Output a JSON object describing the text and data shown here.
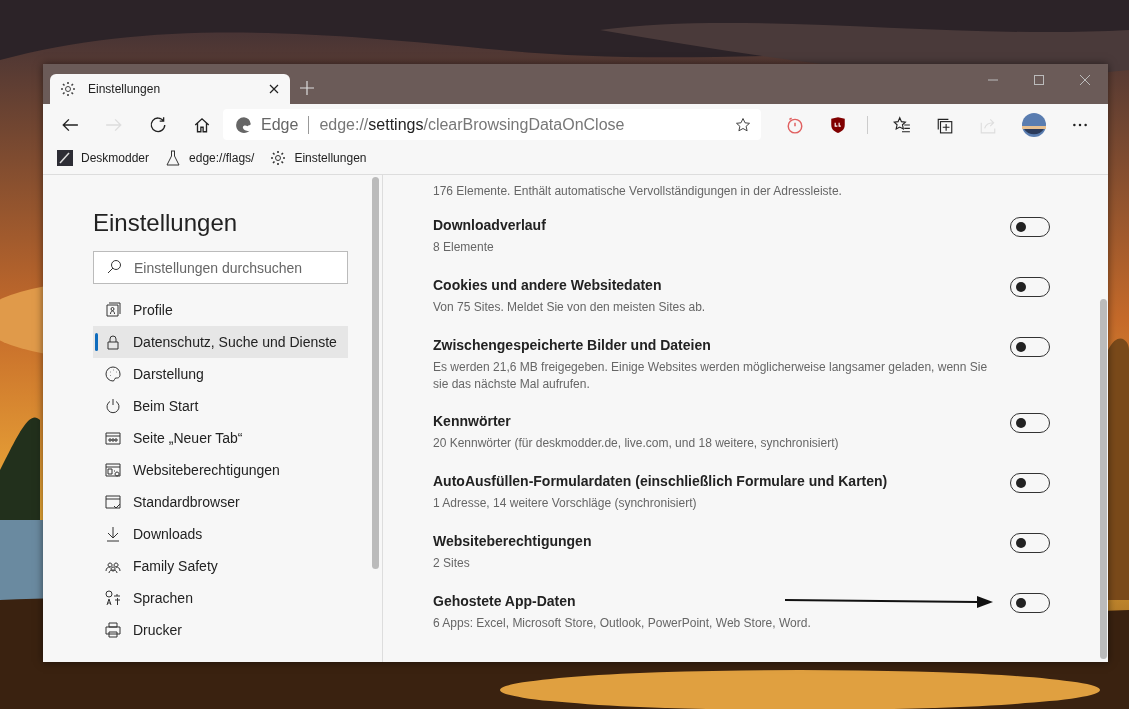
{
  "window": {
    "tab": {
      "title": "Einstellungen",
      "selected": true
    }
  },
  "toolbar_buttons": [
    {
      "kind": "back",
      "disabled": false
    },
    {
      "kind": "forward",
      "disabled": true
    },
    {
      "kind": "refresh",
      "disabled": false
    },
    {
      "kind": "home",
      "disabled": false
    }
  ],
  "address_bar": {
    "brand": "Edge",
    "url": "edge://**settings**/clearBrowsingDataOnClose"
  },
  "extensions": [
    {
      "kind": "timer",
      "disabled": false
    },
    {
      "kind": "shield",
      "disabled": false
    },
    {
      "kind": "favorites",
      "disabled": false
    },
    {
      "kind": "collections",
      "disabled": false
    },
    {
      "kind": "share",
      "disabled": true
    },
    {
      "kind": "avatar",
      "disabled": false
    },
    {
      "kind": "more",
      "disabled": false
    }
  ],
  "bookmarks": [
    {
      "label": "Deskmodder",
      "kind": "site"
    },
    {
      "label": "edge://flags/",
      "kind": "flask"
    },
    {
      "label": "Einstellungen",
      "kind": "gear"
    }
  ],
  "sidebar": {
    "title": "Einstellungen",
    "search": {
      "placeholder": "Einstellungen durchsuchen"
    },
    "items": [
      {
        "label": "Profile",
        "selected": false
      },
      {
        "label": "Datenschutz, Suche und Dienste",
        "selected": true
      },
      {
        "label": "Darstellung",
        "selected": false
      },
      {
        "label": "Beim Start",
        "selected": false
      },
      {
        "label": "Seite „Neuer Tab“",
        "selected": false
      },
      {
        "label": "Websiteberechtigungen",
        "selected": false
      },
      {
        "label": "Standardbrowser",
        "selected": false
      },
      {
        "label": "Downloads",
        "selected": false
      },
      {
        "label": "Family Safety",
        "selected": false
      },
      {
        "label": "Sprachen",
        "selected": false
      },
      {
        "label": "Drucker",
        "selected": false
      }
    ]
  },
  "settings": [
    {
      "kind": "partial",
      "description": "176 Elemente. Enthält automatische Vervollständigungen in der Adressleiste."
    },
    {
      "kind": "toggle",
      "title": "Downloadverlauf",
      "description": "8 Elemente",
      "on": false
    },
    {
      "kind": "toggle",
      "title": "Cookies und andere Websitedaten",
      "description": "Von 75 Sites. Meldet Sie von den meisten Sites ab.",
      "on": false
    },
    {
      "kind": "toggle",
      "title": "Zwischengespeicherte Bilder und Dateien",
      "description": "Es werden 21,6 MB freigegeben. Einige Websites werden möglicherweise langsamer geladen, wenn Sie sie das nächste Mal aufrufen.",
      "on": false
    },
    {
      "kind": "toggle",
      "title": "Kennwörter",
      "description": "20 Kennwörter (für deskmodder.de, live.com, und 18 weitere, synchronisiert)",
      "on": false
    },
    {
      "kind": "toggle",
      "title": "AutoAusfüllen-Formulardaten (einschließlich Formulare und Karten)",
      "description": "1 Adresse, 14 weitere Vorschläge (synchronisiert)",
      "on": false
    },
    {
      "kind": "toggle",
      "title": "Websiteberechtigungen",
      "description": "2 Sites",
      "on": false
    },
    {
      "kind": "toggle",
      "title": "Gehostete App-Daten",
      "description": "6 Apps: Excel, Microsoft Store, Outlook, PowerPoint, Web Store, Word.",
      "on": false,
      "pointer": true
    }
  ]
}
